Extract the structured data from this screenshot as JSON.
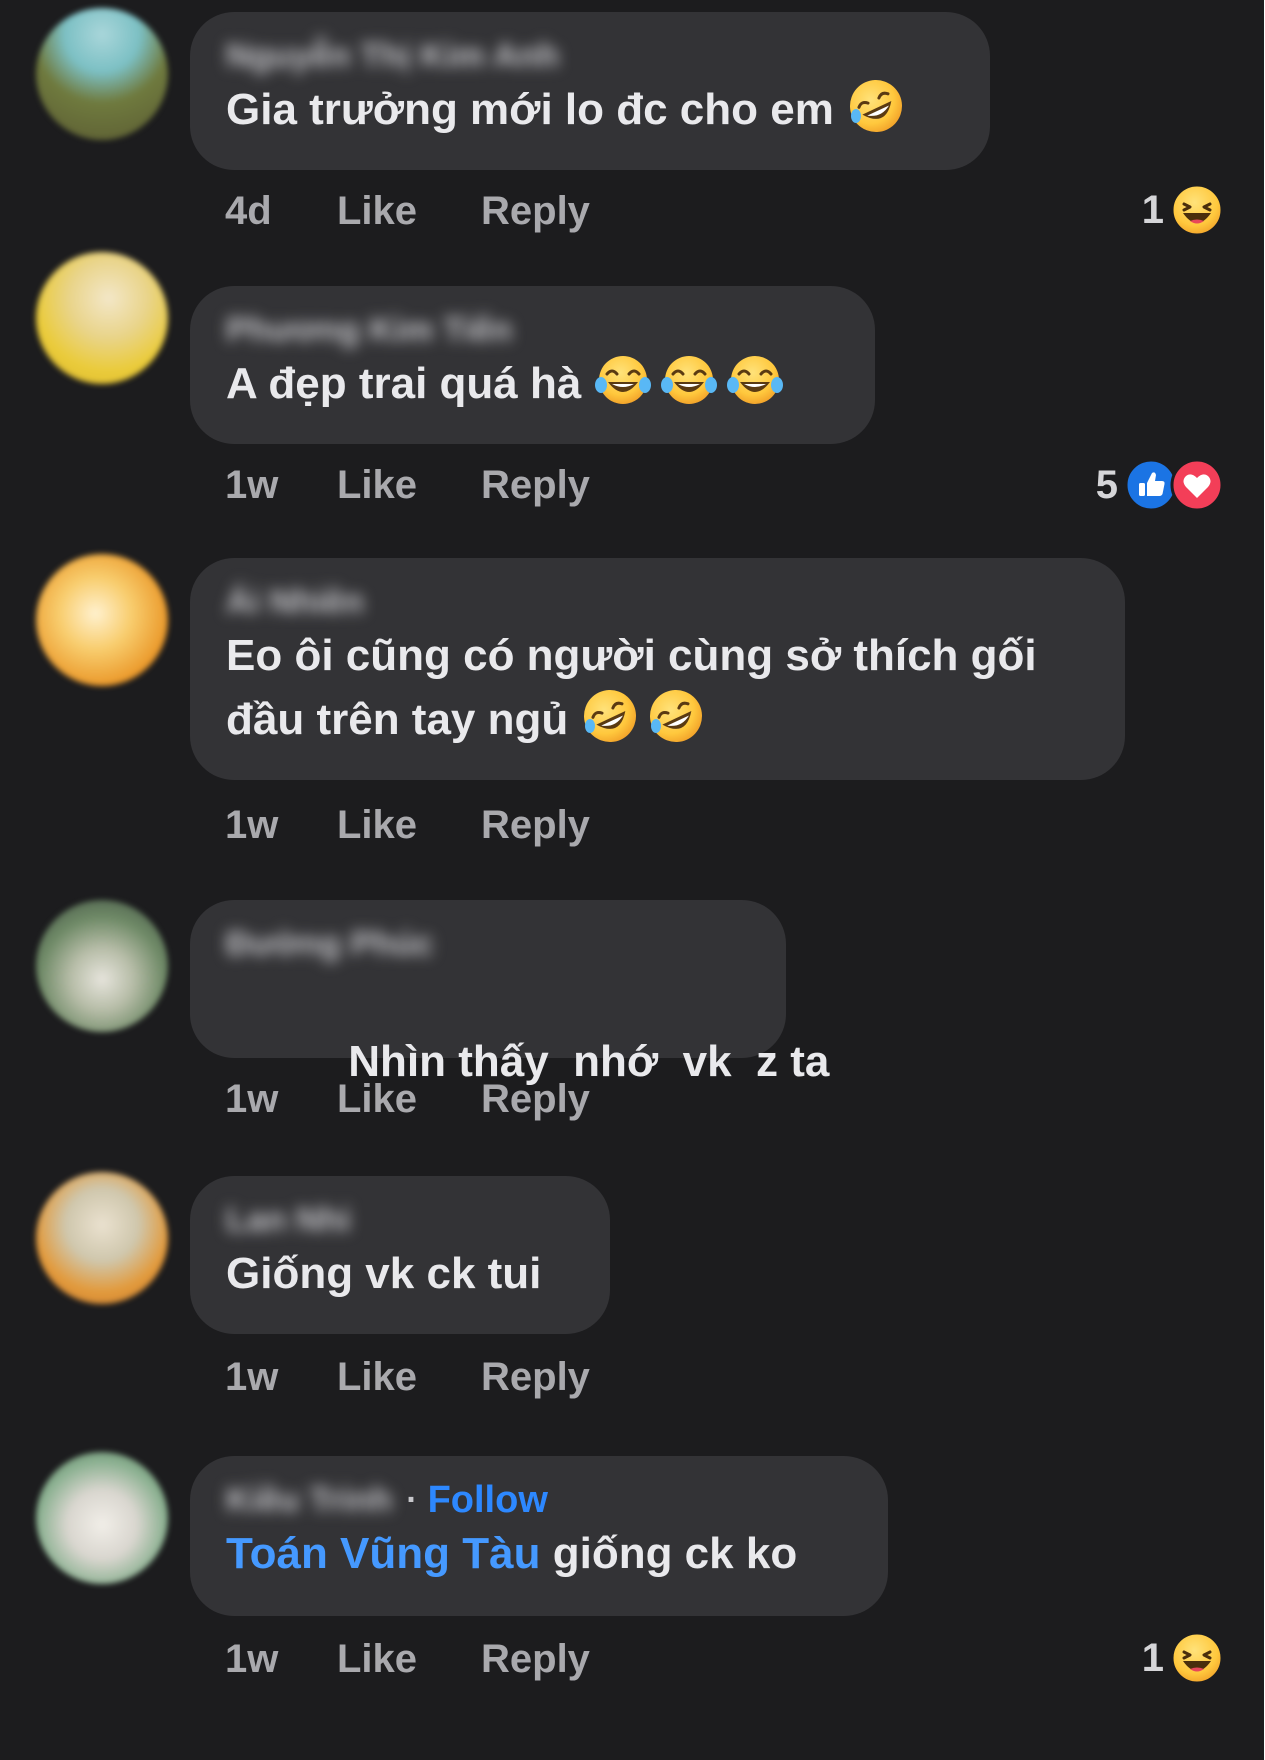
{
  "colors": {
    "background": "#1c1c1e",
    "bubble": "#333336",
    "text": "#e9e9ec",
    "meta": "#a9a9ad",
    "link": "#2d88ff"
  },
  "comments": [
    {
      "author": "Nguyễn Thị Kim Anh",
      "text": "Gia trưởng mới lo đc cho em",
      "emojis": [
        "rolling-on-floor-laughing-emoji"
      ],
      "time": "4d",
      "like_label": "Like",
      "reply_label": "Reply",
      "reaction_count": "1",
      "reactions": [
        "haha-reaction"
      ]
    },
    {
      "author": "Phương Kim Tiến",
      "text": "A đẹp trai quá hà",
      "emojis": [
        "tears-of-joy-emoji",
        "tears-of-joy-emoji",
        "tears-of-joy-emoji"
      ],
      "time": "1w",
      "like_label": "Like",
      "reply_label": "Reply",
      "reaction_count": "5",
      "reactions": [
        "like-reaction",
        "love-reaction"
      ]
    },
    {
      "author": "Ái Nhiên",
      "text_line1": "Eo ôi cũng có người cùng sở thích gối",
      "text_line2": "đầu trên tay ngủ",
      "emojis": [
        "rolling-on-floor-laughing-emoji",
        "rolling-on-floor-laughing-emoji"
      ],
      "time": "1w",
      "like_label": "Like",
      "reply_label": "Reply"
    },
    {
      "author": "Đường Phúc",
      "text": "Nhìn thấy  nhớ  vk  z ta",
      "time": "1w",
      "like_label": "Like",
      "reply_label": "Reply"
    },
    {
      "author": "Lan Nhi",
      "text": "Giống vk ck tui",
      "time": "1w",
      "like_label": "Like",
      "reply_label": "Reply"
    },
    {
      "author": "Kiều Trinh",
      "separator": "·",
      "follow_label": "Follow",
      "mention": "Toán Vũng Tàu",
      "text": " giống ck ko",
      "time": "1w",
      "like_label": "Like",
      "reply_label": "Reply",
      "reaction_count": "1",
      "reactions": [
        "haha-reaction"
      ]
    }
  ]
}
